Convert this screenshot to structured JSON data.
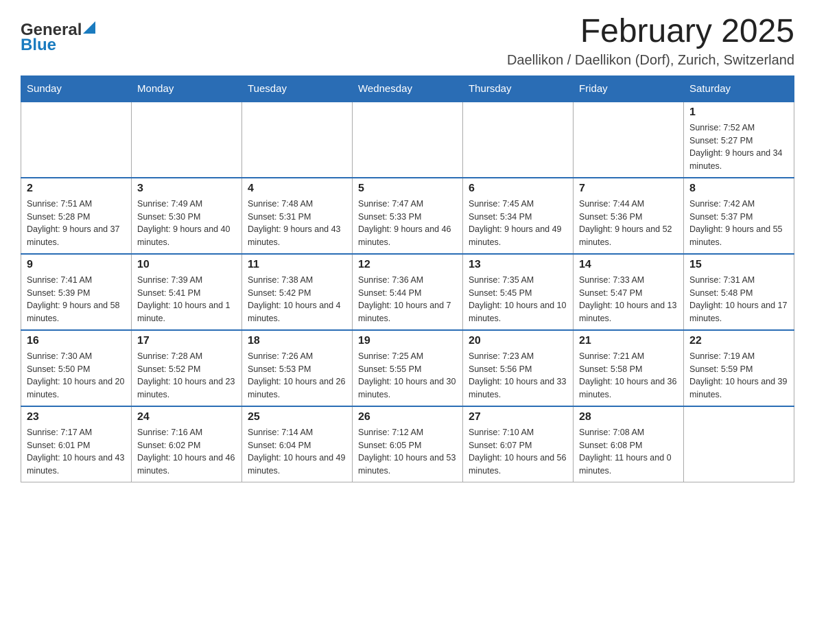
{
  "logo": {
    "general": "General",
    "blue": "Blue"
  },
  "header": {
    "title": "February 2025",
    "subtitle": "Daellikon / Daellikon (Dorf), Zurich, Switzerland"
  },
  "weekdays": [
    "Sunday",
    "Monday",
    "Tuesday",
    "Wednesday",
    "Thursday",
    "Friday",
    "Saturday"
  ],
  "weeks": [
    [
      {
        "day": "",
        "info": ""
      },
      {
        "day": "",
        "info": ""
      },
      {
        "day": "",
        "info": ""
      },
      {
        "day": "",
        "info": ""
      },
      {
        "day": "",
        "info": ""
      },
      {
        "day": "",
        "info": ""
      },
      {
        "day": "1",
        "info": "Sunrise: 7:52 AM\nSunset: 5:27 PM\nDaylight: 9 hours and 34 minutes."
      }
    ],
    [
      {
        "day": "2",
        "info": "Sunrise: 7:51 AM\nSunset: 5:28 PM\nDaylight: 9 hours and 37 minutes."
      },
      {
        "day": "3",
        "info": "Sunrise: 7:49 AM\nSunset: 5:30 PM\nDaylight: 9 hours and 40 minutes."
      },
      {
        "day": "4",
        "info": "Sunrise: 7:48 AM\nSunset: 5:31 PM\nDaylight: 9 hours and 43 minutes."
      },
      {
        "day": "5",
        "info": "Sunrise: 7:47 AM\nSunset: 5:33 PM\nDaylight: 9 hours and 46 minutes."
      },
      {
        "day": "6",
        "info": "Sunrise: 7:45 AM\nSunset: 5:34 PM\nDaylight: 9 hours and 49 minutes."
      },
      {
        "day": "7",
        "info": "Sunrise: 7:44 AM\nSunset: 5:36 PM\nDaylight: 9 hours and 52 minutes."
      },
      {
        "day": "8",
        "info": "Sunrise: 7:42 AM\nSunset: 5:37 PM\nDaylight: 9 hours and 55 minutes."
      }
    ],
    [
      {
        "day": "9",
        "info": "Sunrise: 7:41 AM\nSunset: 5:39 PM\nDaylight: 9 hours and 58 minutes."
      },
      {
        "day": "10",
        "info": "Sunrise: 7:39 AM\nSunset: 5:41 PM\nDaylight: 10 hours and 1 minute."
      },
      {
        "day": "11",
        "info": "Sunrise: 7:38 AM\nSunset: 5:42 PM\nDaylight: 10 hours and 4 minutes."
      },
      {
        "day": "12",
        "info": "Sunrise: 7:36 AM\nSunset: 5:44 PM\nDaylight: 10 hours and 7 minutes."
      },
      {
        "day": "13",
        "info": "Sunrise: 7:35 AM\nSunset: 5:45 PM\nDaylight: 10 hours and 10 minutes."
      },
      {
        "day": "14",
        "info": "Sunrise: 7:33 AM\nSunset: 5:47 PM\nDaylight: 10 hours and 13 minutes."
      },
      {
        "day": "15",
        "info": "Sunrise: 7:31 AM\nSunset: 5:48 PM\nDaylight: 10 hours and 17 minutes."
      }
    ],
    [
      {
        "day": "16",
        "info": "Sunrise: 7:30 AM\nSunset: 5:50 PM\nDaylight: 10 hours and 20 minutes."
      },
      {
        "day": "17",
        "info": "Sunrise: 7:28 AM\nSunset: 5:52 PM\nDaylight: 10 hours and 23 minutes."
      },
      {
        "day": "18",
        "info": "Sunrise: 7:26 AM\nSunset: 5:53 PM\nDaylight: 10 hours and 26 minutes."
      },
      {
        "day": "19",
        "info": "Sunrise: 7:25 AM\nSunset: 5:55 PM\nDaylight: 10 hours and 30 minutes."
      },
      {
        "day": "20",
        "info": "Sunrise: 7:23 AM\nSunset: 5:56 PM\nDaylight: 10 hours and 33 minutes."
      },
      {
        "day": "21",
        "info": "Sunrise: 7:21 AM\nSunset: 5:58 PM\nDaylight: 10 hours and 36 minutes."
      },
      {
        "day": "22",
        "info": "Sunrise: 7:19 AM\nSunset: 5:59 PM\nDaylight: 10 hours and 39 minutes."
      }
    ],
    [
      {
        "day": "23",
        "info": "Sunrise: 7:17 AM\nSunset: 6:01 PM\nDaylight: 10 hours and 43 minutes."
      },
      {
        "day": "24",
        "info": "Sunrise: 7:16 AM\nSunset: 6:02 PM\nDaylight: 10 hours and 46 minutes."
      },
      {
        "day": "25",
        "info": "Sunrise: 7:14 AM\nSunset: 6:04 PM\nDaylight: 10 hours and 49 minutes."
      },
      {
        "day": "26",
        "info": "Sunrise: 7:12 AM\nSunset: 6:05 PM\nDaylight: 10 hours and 53 minutes."
      },
      {
        "day": "27",
        "info": "Sunrise: 7:10 AM\nSunset: 6:07 PM\nDaylight: 10 hours and 56 minutes."
      },
      {
        "day": "28",
        "info": "Sunrise: 7:08 AM\nSunset: 6:08 PM\nDaylight: 11 hours and 0 minutes."
      },
      {
        "day": "",
        "info": ""
      }
    ]
  ]
}
